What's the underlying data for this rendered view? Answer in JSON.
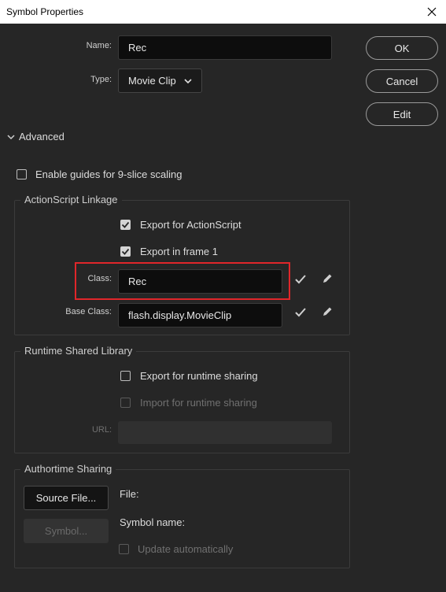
{
  "window": {
    "title": "Symbol Properties"
  },
  "name": {
    "label": "Name:",
    "value": "Rec"
  },
  "type": {
    "label": "Type:",
    "value": "Movie Clip"
  },
  "buttons": {
    "ok": "OK",
    "cancel": "Cancel",
    "edit": "Edit"
  },
  "advanced": {
    "label": "Advanced",
    "expanded": true
  },
  "nine_slice": {
    "label": "Enable guides for 9-slice scaling",
    "checked": false
  },
  "actionscript": {
    "title": "ActionScript Linkage",
    "export_as": {
      "label": "Export for ActionScript",
      "checked": true
    },
    "export_frame1": {
      "label": "Export in frame 1",
      "checked": true
    },
    "class": {
      "label": "Class:",
      "value": "Rec"
    },
    "base_class": {
      "label": "Base Class:",
      "value": "flash.display.MovieClip"
    }
  },
  "runtime": {
    "title": "Runtime Shared Library",
    "export_runtime": {
      "label": "Export for runtime sharing",
      "checked": false
    },
    "import_runtime": {
      "label": "Import for runtime sharing",
      "checked": false
    },
    "url": {
      "label": "URL:",
      "value": ""
    }
  },
  "authortime": {
    "title": "Authortime Sharing",
    "source_file": "Source File...",
    "symbol": "Symbol...",
    "file_label": "File:",
    "symbol_name_label": "Symbol name:",
    "update_auto": {
      "label": "Update automatically",
      "checked": false
    }
  },
  "colors": {
    "background": "#262626",
    "highlight": "#e0262a",
    "titlebar": "#ffffff"
  }
}
